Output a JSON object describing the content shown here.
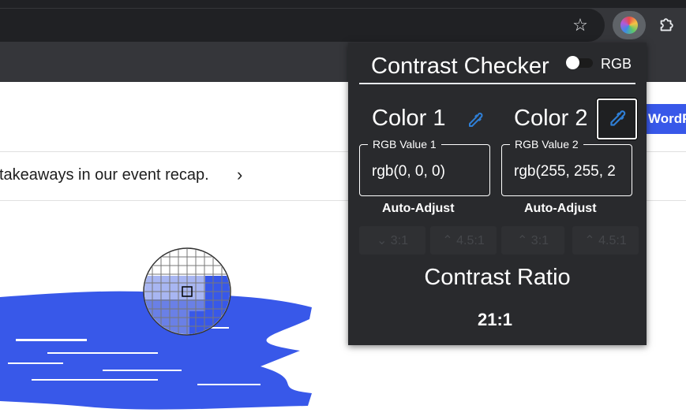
{
  "browser": {
    "star_icon": "star-icon",
    "extension_icon": "contrast-checker-extension-icon",
    "puzzle_icon": "puzzle-icon"
  },
  "page": {
    "header_button": "WordPress",
    "announcement": "takeaways in our event recap.",
    "announcement_arrow": "›",
    "brand_color": "#3858e9"
  },
  "popup": {
    "title": "Contrast Checker",
    "toggle_label": "RGB",
    "color1": {
      "label": "Color 1",
      "field_label": "RGB Value 1",
      "value": "rgb(0, 0, 0)",
      "auto_adjust": "Auto-Adjust",
      "buttons": [
        "⌄ 3:1",
        "⌃ 4.5:1"
      ]
    },
    "color2": {
      "label": "Color 2",
      "field_label": "RGB Value 2",
      "value": "rgb(255, 255, 2",
      "auto_adjust": "Auto-Adjust",
      "buttons": [
        "⌃ 3:1",
        "⌃ 4.5:1"
      ]
    },
    "ratio_title": "Contrast Ratio",
    "ratio_value": "21:1",
    "accent_color": "#2f7fd6",
    "background_color": "#292a2d"
  }
}
